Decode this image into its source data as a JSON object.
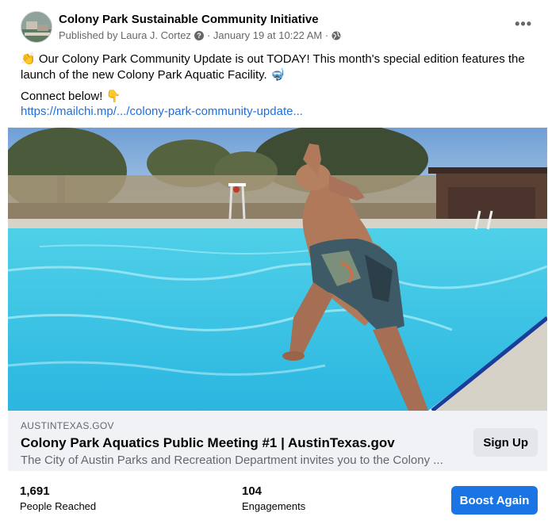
{
  "post": {
    "page_name": "Colony Park Sustainable Community Initiative",
    "published_by": "Published by Laura J. Cortez",
    "date": "· January 19 at 10:22 AM ·",
    "text_emoji_start": "👏",
    "text": "Our Colony Park Community Update is out TODAY! This month's special edition features the launch of the new Colony Park Aquatic Facility.",
    "text_emoji_end": "🤿",
    "connect": "Connect below!",
    "connect_emoji": "👇",
    "link": "https://mailchi.mp/.../colony-park-community-update..."
  },
  "link_card": {
    "domain": "AUSTINTEXAS.GOV",
    "title": "Colony Park Aquatics Public Meeting #1 | AustinTexas.gov",
    "description": "The City of Austin Parks and Recreation Department invites you to the Colony ...",
    "button": "Sign Up"
  },
  "stats": {
    "reached_value": "1,691",
    "reached_label": "People Reached",
    "engagements_value": "104",
    "engagements_label": "Engagements",
    "boost_button": "Boost Again"
  },
  "icons": {
    "help": "question-circle-icon",
    "privacy": "globe-icon",
    "more": "more-options-icon"
  },
  "colors": {
    "link": "#216fdb",
    "boost": "#1b74e4",
    "card_bg": "#f0f2f5"
  }
}
